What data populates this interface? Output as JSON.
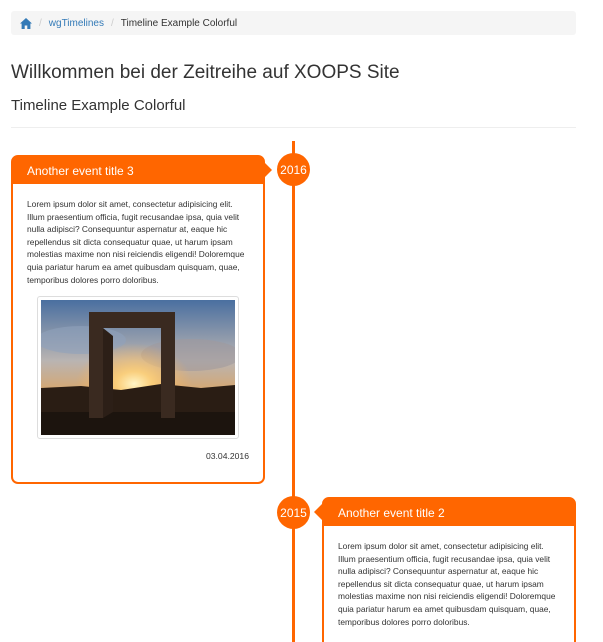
{
  "breadcrumb": {
    "home_icon": "home-icon",
    "separator": "/",
    "module_link": "wgTimelines",
    "current": "Timeline Example Colorful"
  },
  "header": {
    "title": "Willkommen bei der Zeitreihe auf XOOPS Site",
    "subtitle": "Timeline Example Colorful"
  },
  "theme": {
    "accent": "#ff6600",
    "breadcrumb_bg": "#f5f5f5",
    "link": "#337ab7"
  },
  "timeline": {
    "events": [
      {
        "year": "2016",
        "title": "Another event title 3",
        "text": "Lorem ipsum dolor sit amet, consectetur adipisicing elit. Illum praesentium officia, fugit recusandae ipsa, quia velit nulla adipisci? Consequuntur aspernatur at, eaque hic repellendus sit dicta consequatur quae, ut harum ipsam molestias maxime non nisi reiciendis eligendi! Doloremque quia pariatur harum ea amet quibusdam quisquam, quae, temporibus dolores porro doloribus.",
        "image": "sunset-landscape-image",
        "date": "03.04.2016"
      },
      {
        "year": "2015",
        "title": "Another event title 2",
        "text": "Lorem ipsum dolor sit amet, consectetur adipisicing elit. Illum praesentium officia, fugit recusandae ipsa, quia velit nulla adipisci? Consequuntur aspernatur at, eaque hic repellendus sit dicta consequatur quae, ut harum ipsam molestias maxime non nisi reiciendis eligendi! Doloremque quia pariatur harum ea amet quibusdam quisquam, quae, temporibus dolores porro doloribus."
      }
    ]
  }
}
